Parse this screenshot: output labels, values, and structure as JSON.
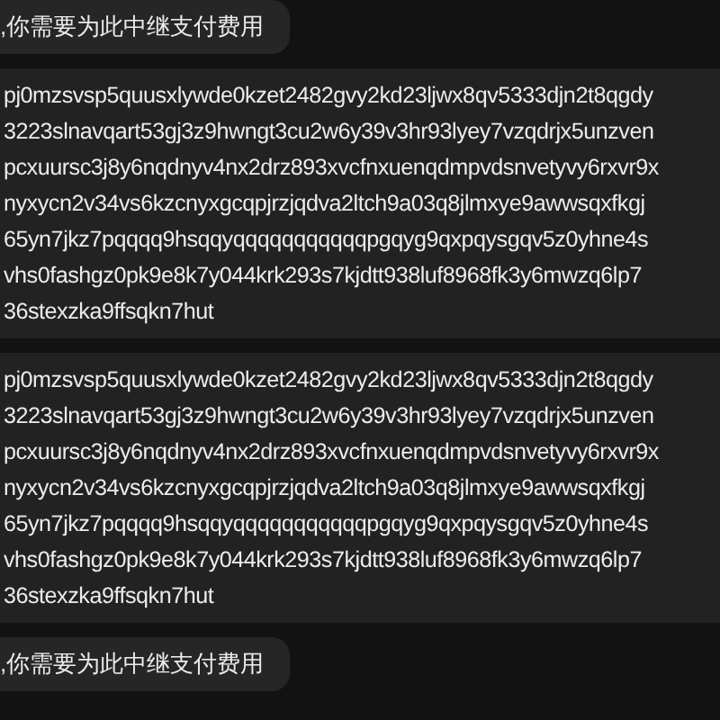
{
  "messages": [
    {
      "kind": "bubble",
      "text": ",你需要为此中继支付费用"
    },
    {
      "kind": "block",
      "lines": [
        "pj0mzsvsp5quusxlywde0kzet2482gvy2kd23ljwx8qv5333djn2t8qgdy",
        "3223slnavqart53gj3z9hwngt3cu2w6y39v3hr93lyey7vzqdrjx5unzven",
        "pcxuursc3j8y6nqdnyv4nx2drz893xvcfnxuenqdmpvdsnvetyvy6rxvr9x",
        "nyxycn2v34vs6kzcnyxgcqpjrzjqdva2ltch9a03q8jlmxye9awwsqxfkgj",
        "65yn7jkz7pqqqq9hsqqyqqqqqqqqqqqpgqyg9qxpqysgqv5z0yhne4s",
        "vhs0fashgz0pk9e8k7y044krk293s7kjdtt938luf8968fk3y6mwzq6lp7",
        "36stexzka9ffsqkn7hut"
      ]
    },
    {
      "kind": "block",
      "lines": [
        "pj0mzsvsp5quusxlywde0kzet2482gvy2kd23ljwx8qv5333djn2t8qgdy",
        "3223slnavqart53gj3z9hwngt3cu2w6y39v3hr93lyey7vzqdrjx5unzven",
        "pcxuursc3j8y6nqdnyv4nx2drz893xvcfnxuenqdmpvdsnvetyvy6rxvr9x",
        "nyxycn2v34vs6kzcnyxgcqpjrzjqdva2ltch9a03q8jlmxye9awwsqxfkgj",
        "65yn7jkz7pqqqq9hsqqyqqqqqqqqqqqpgqyg9qxpqysgqv5z0yhne4s",
        "vhs0fashgz0pk9e8k7y044krk293s7kjdtt938luf8968fk3y6mwzq6lp7",
        "36stexzka9ffsqkn7hut"
      ]
    },
    {
      "kind": "bubble",
      "text": ",你需要为此中继支付费用"
    }
  ]
}
